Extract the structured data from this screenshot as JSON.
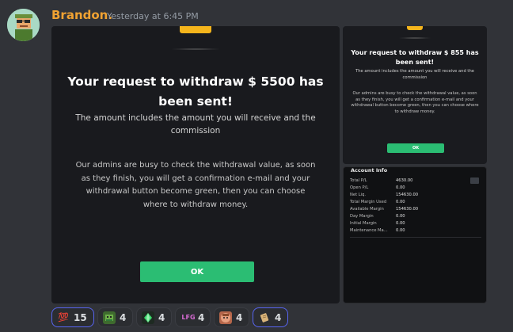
{
  "message": {
    "username": "Brandon.",
    "timestamp": "Yesterday at 6:45 PM"
  },
  "large_modal": {
    "title": "Your request to withdraw $ 5500 has been sent!",
    "subtitle": "The amount includes the amount you will receive and the commission",
    "body": "Our admins are busy to check the withdrawal value, as soon as they finish, you will get a confirmation e-mail and your withdrawal button become green, then you can choose where to withdraw money.",
    "ok_label": "OK"
  },
  "small_modal": {
    "title": "Your request to withdraw $ 855 has been sent!",
    "subtitle": "The amount includes the amount you will receive and the commission",
    "body": "Our admins are busy to check the withdrawal value, as soon as they finish, you will get a confirmation e-mail and your withdrawal button become green, then you can choose where to withdraw money.",
    "ok_label": "OK"
  },
  "account_info": {
    "title": "Account Info",
    "rows": [
      {
        "label": "Total P/L",
        "value": "4630.00"
      },
      {
        "label": "Open P/L",
        "value": "0.00"
      },
      {
        "label": "Net Liq.",
        "value": "154630.00"
      },
      {
        "label": "Total Margin Used",
        "value": "0.00"
      },
      {
        "label": "Available Margin",
        "value": "154630.00"
      },
      {
        "label": "Day Margin",
        "value": "0.00"
      },
      {
        "label": "Initial Margin",
        "value": "0.00"
      },
      {
        "label": "Maintenance Ma...",
        "value": "0.00"
      }
    ]
  },
  "reactions": [
    {
      "emoji": "100-icon",
      "glyph": "💯",
      "count": "15"
    },
    {
      "emoji": "pepe-money-icon",
      "glyph": "",
      "count": "4"
    },
    {
      "emoji": "green-gem-icon",
      "glyph": "",
      "count": "4"
    },
    {
      "emoji": "lfg-icon",
      "glyph": "LFG",
      "count": "4"
    },
    {
      "emoji": "face-icon",
      "glyph": "",
      "count": "4"
    },
    {
      "emoji": "scroll-icon",
      "glyph": "",
      "count": "4"
    }
  ],
  "colors": {
    "username": "#f0a232",
    "ok_button": "#2bbd73",
    "accent_tab": "#f5b51c",
    "reaction_border": "#5865f2"
  }
}
